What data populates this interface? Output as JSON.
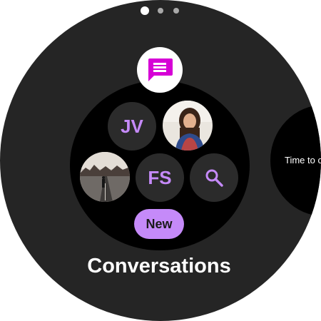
{
  "pager": {
    "active_index": 0,
    "count": 3
  },
  "app": {
    "icon": "message-icon",
    "icon_color": "#d600d6"
  },
  "contacts": [
    {
      "type": "initials",
      "initials": "JV"
    },
    {
      "type": "photo",
      "icon": "portrait-photo"
    },
    {
      "type": "photo",
      "icon": "road-photo"
    },
    {
      "type": "initials",
      "initials": "FS"
    }
  ],
  "search": {
    "icon": "search-icon"
  },
  "new_button": {
    "label": "New"
  },
  "screen": {
    "title": "Conversations"
  },
  "next_tile": {
    "text": "Time to c"
  },
  "colors": {
    "accent": "#c58af9",
    "face": "#252525",
    "inner": "#000000",
    "bubble": "#2b2b2b"
  }
}
